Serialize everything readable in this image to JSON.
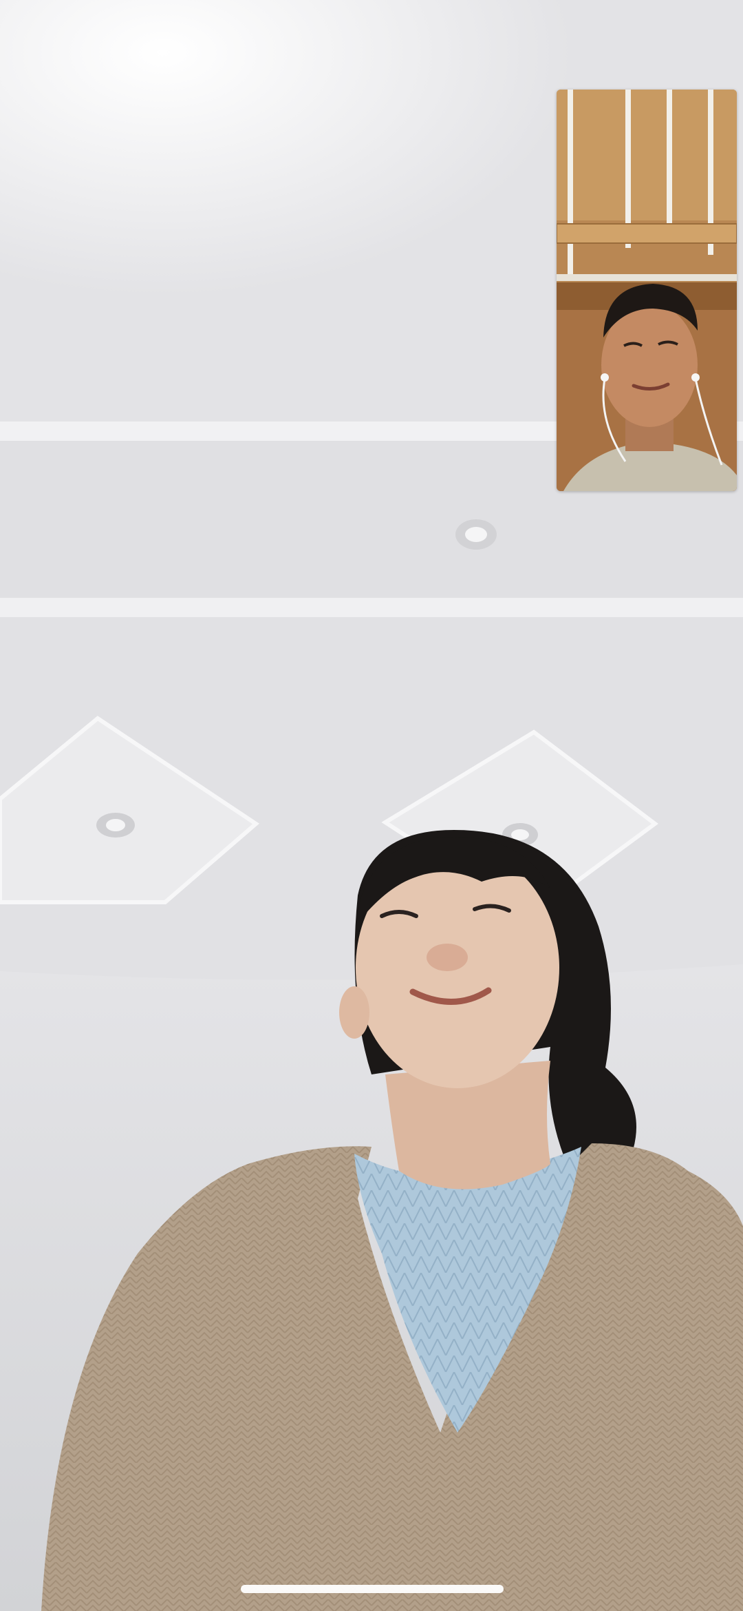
{
  "screen": {
    "type": "video-call",
    "remote_video": {
      "description_icon": "remote-participant-video"
    },
    "self_view": {
      "description_icon": "self-preview-video"
    },
    "home_indicator": {
      "color": "#ffffff"
    }
  },
  "colors": {
    "ceiling": "#e6e6e8",
    "wall": "#dcdde0",
    "cardigan": "#b29f88",
    "sweater": "#a9c4d8",
    "hair": "#1a1716",
    "skin": "#e3c3ac",
    "wood": "#b78552"
  }
}
